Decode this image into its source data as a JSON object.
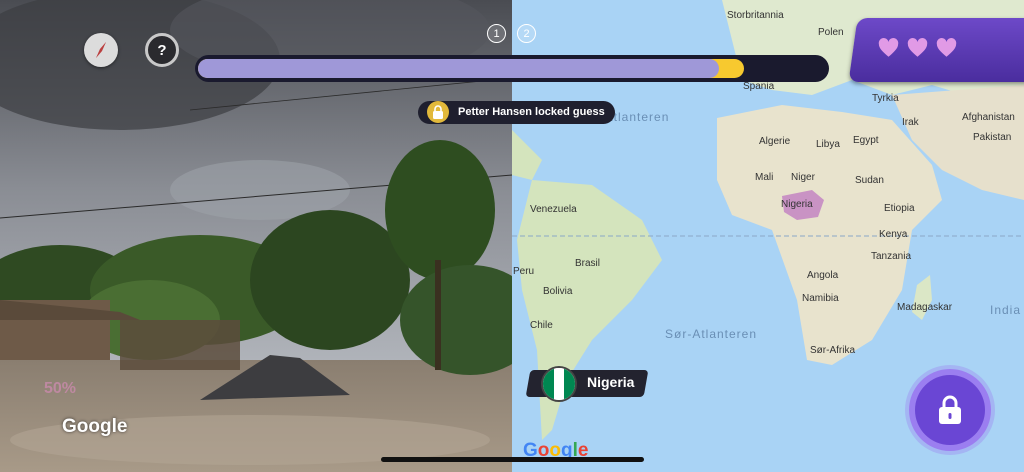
{
  "rounds": {
    "r1": "1",
    "r2": "2"
  },
  "progress": {
    "value": 0.83,
    "marker": 0.87
  },
  "notification": {
    "text": "Petter Hansen locked guess"
  },
  "lives": {
    "count": 3,
    "color": "#e19ae6",
    "icon": "heart-icon"
  },
  "guess": {
    "country": "Nigeria",
    "flag_colors": [
      "#008751",
      "#ffffff",
      "#008751"
    ]
  },
  "attribution": {
    "left": "Google",
    "right": "Google"
  },
  "map_labels": [
    {
      "id": "storbritannia",
      "text": "Storbritannia"
    },
    {
      "id": "polen",
      "text": "Polen"
    },
    {
      "id": "spania",
      "text": "Spania"
    },
    {
      "id": "tyrkia",
      "text": "Tyrkia"
    },
    {
      "id": "algerie",
      "text": "Algerie"
    },
    {
      "id": "libya",
      "text": "Libya"
    },
    {
      "id": "egypt",
      "text": "Egypt"
    },
    {
      "id": "irak",
      "text": "Irak"
    },
    {
      "id": "afghanistan",
      "text": "Afghanistan"
    },
    {
      "id": "pakistan",
      "text": "Pakistan"
    },
    {
      "id": "mali",
      "text": "Mali"
    },
    {
      "id": "niger",
      "text": "Niger"
    },
    {
      "id": "sudan",
      "text": "Sudan"
    },
    {
      "id": "nigeria",
      "text": "Nigeria"
    },
    {
      "id": "etiopia",
      "text": "Etiopia"
    },
    {
      "id": "venezuela",
      "text": "Venezuela"
    },
    {
      "id": "kenya",
      "text": "Kenya"
    },
    {
      "id": "brasil",
      "text": "Brasil"
    },
    {
      "id": "peru",
      "text": "Peru"
    },
    {
      "id": "tanzania",
      "text": "Tanzania"
    },
    {
      "id": "bolivia",
      "text": "Bolivia"
    },
    {
      "id": "angola",
      "text": "Angola"
    },
    {
      "id": "namibia",
      "text": "Namibia"
    },
    {
      "id": "madagaskar",
      "text": "Madagaskar"
    },
    {
      "id": "chile",
      "text": "Chile"
    },
    {
      "id": "sor-afrika",
      "text": "Sør-Afrika"
    }
  ],
  "ocean_labels": {
    "nord": "d-Atlanteren",
    "sor": "Sør-Atlanteren",
    "india": "India"
  },
  "colors": {
    "accent": "#6a46d4",
    "progress": "#9f98d8",
    "highlight": "#f7c92f"
  }
}
